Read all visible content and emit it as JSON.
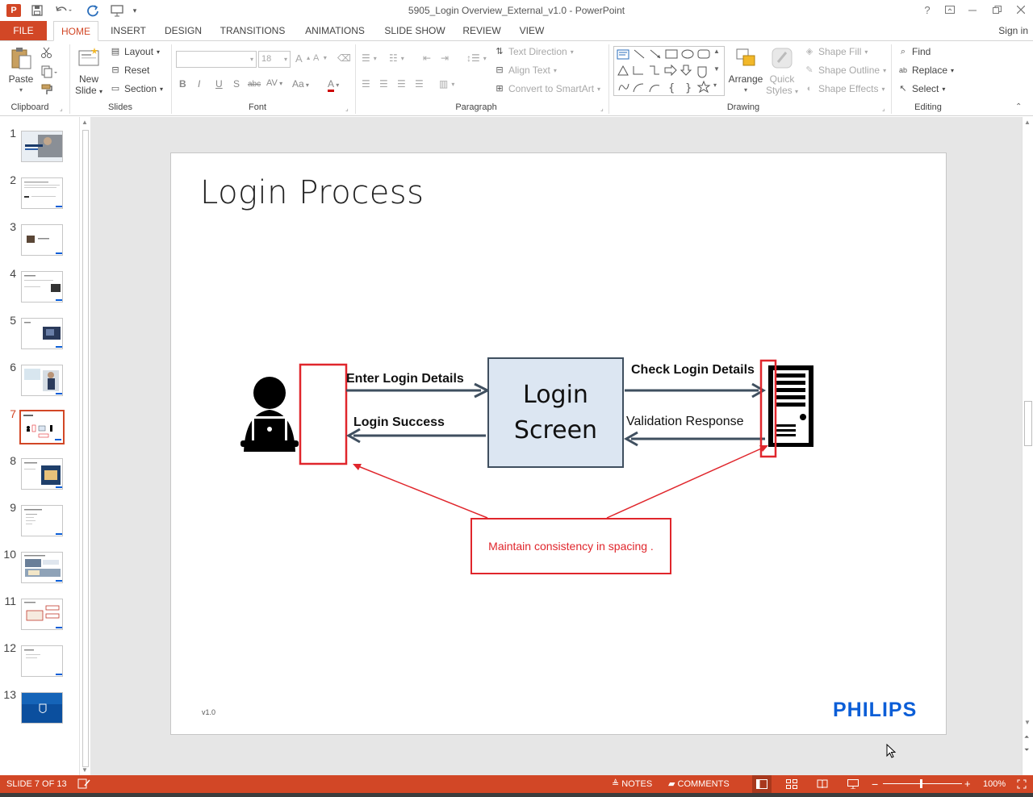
{
  "window": {
    "title": "5905_Login Overview_External_v1.0 - PowerPoint",
    "help": "?",
    "signin": "Sign in"
  },
  "tabs": {
    "file": "FILE",
    "items": [
      "HOME",
      "INSERT",
      "DESIGN",
      "TRANSITIONS",
      "ANIMATIONS",
      "SLIDE SHOW",
      "REVIEW",
      "VIEW"
    ],
    "active": "HOME"
  },
  "ribbon": {
    "clipboard": {
      "label": "Clipboard",
      "paste": "Paste"
    },
    "slides": {
      "label": "Slides",
      "new_slide_1": "New",
      "new_slide_2": "Slide",
      "layout": "Layout",
      "reset": "Reset",
      "section": "Section"
    },
    "font": {
      "label": "Font",
      "size": "18",
      "bold": "B",
      "italic": "I",
      "underline": "U",
      "shadow": "S",
      "strike": "abc",
      "spacing": "AV",
      "case": "Aa",
      "color": "A",
      "grow": "A",
      "shrink": "A"
    },
    "paragraph": {
      "label": "Paragraph",
      "text_direction": "Text Direction",
      "align_text": "Align Text",
      "convert_smartart": "Convert to SmartArt"
    },
    "drawing": {
      "label": "Drawing",
      "arrange": "Arrange",
      "quick_styles_1": "Quick",
      "quick_styles_2": "Styles",
      "shape_fill": "Shape Fill",
      "shape_outline": "Shape Outline",
      "shape_effects": "Shape Effects"
    },
    "editing": {
      "label": "Editing",
      "find": "Find",
      "replace": "Replace",
      "select": "Select"
    }
  },
  "thumbnails": {
    "numbers": [
      "1",
      "2",
      "3",
      "4",
      "5",
      "6",
      "7",
      "8",
      "9",
      "10",
      "11",
      "12",
      "13"
    ],
    "active_index": 6
  },
  "slide": {
    "title": "Login Process",
    "version": "v1.0",
    "logo": "PHILIPS",
    "diagram": {
      "enter_login": "Enter Login  Details",
      "login_success": "Login Success",
      "login_screen_1": "Login",
      "login_screen_2": "Screen",
      "check_login": "Check Login Details",
      "validation": "Validation Response",
      "callout": "Maintain consistency in spacing ."
    }
  },
  "status": {
    "slide_info": "SLIDE 7 OF 13",
    "notes": "NOTES",
    "comments": "COMMENTS",
    "zoom": "100%"
  },
  "colors": {
    "accent": "#d24726",
    "callout_red": "#e0262c",
    "philips_blue": "#0b5ed7",
    "login_box_fill": "#dce6f2",
    "arrow": "#3f4f5f"
  }
}
